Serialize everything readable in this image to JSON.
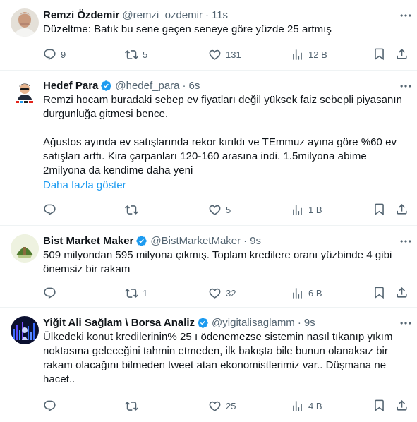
{
  "colors": {
    "text": "#0f1419",
    "muted": "#536471",
    "link": "#1d9bf0",
    "verified": "#1d9bf0",
    "divider": "#eff3f4"
  },
  "icons": [
    "more-icon",
    "reply-icon",
    "retweet-icon",
    "like-icon",
    "views-icon",
    "bookmark-icon",
    "share-icon",
    "verified-icon"
  ],
  "tweets": [
    {
      "name": "Remzi Özdemir",
      "handle": "@remzi_ozdemir",
      "separator": "·",
      "time": "11s",
      "verified": false,
      "text": "Düzeltme: Batık bu sene geçen seneye göre yüzde 25 artmış",
      "show_more": "",
      "replies": "9",
      "retweets": "5",
      "likes": "131",
      "views": "12 B"
    },
    {
      "name": "Hedef Para",
      "handle": "@hedef_para",
      "separator": "·",
      "time": "6s",
      "verified": true,
      "text": "Remzi hocam buradaki sebep ev fiyatları değil yüksek faiz sebepli piyasanın\ndurgunluğa gitmesi bence.\n\nAğustos ayında ev satışlarında rekor kırıldı ve TEmmuz ayına göre %60 ev\nsatışları arttı. Kira çarpanları 120-160 arasına indi. 1.5milyona abime\n2milyona da kendime daha yeni",
      "show_more": "Daha fazla göster",
      "replies": "",
      "retweets": "",
      "likes": "5",
      "views": "1 B"
    },
    {
      "name": "Bist Market Maker",
      "handle": "@BistMarketMaker",
      "separator": "·",
      "time": "9s",
      "verified": true,
      "text": "509 milyondan 595 milyona çıkmış. Toplam kredilere oranı yüzbinde 4 gibi\nönemsiz bir rakam",
      "show_more": "",
      "replies": "",
      "retweets": "1",
      "likes": "32",
      "views": "6 B"
    },
    {
      "name": "Yiğit Ali Sağlam \\ Borsa Analiz",
      "handle": "@yigitalisaglamm",
      "separator": "·",
      "time": "9s",
      "verified": true,
      "text": "Ülkedeki konut kredilerinin% 25 ı ödenemezse sistemin nasıl tıkanıp yıkım\nnoktasına geleceğini tahmin etmeden, ilk bakışta bile bunun olanaksız bir\nrakam olacağını bilmeden tweet atan ekonomistlerimiz var.. Düşmana ne\nhacet..",
      "show_more": "",
      "replies": "",
      "retweets": "",
      "likes": "25",
      "views": "4 B"
    }
  ]
}
